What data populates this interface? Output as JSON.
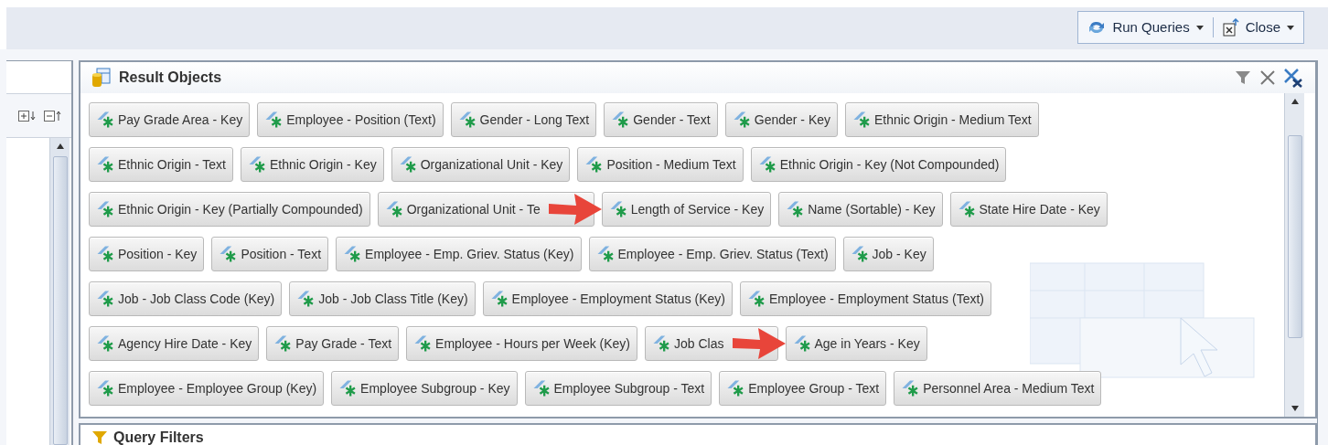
{
  "toolbar": {
    "buttons": [
      {
        "label": "Run Queries",
        "kind": "refresh"
      },
      {
        "label": "Close",
        "kind": "close"
      }
    ]
  },
  "result_objects": {
    "title": "Result Objects",
    "rows": [
      [
        {
          "label": "Pay Grade Area - Key",
          "arrow": false
        },
        {
          "label": "Employee - Position (Text)",
          "arrow": false
        },
        {
          "label": "Gender - Long Text",
          "arrow": false
        },
        {
          "label": "Gender - Text",
          "arrow": false
        },
        {
          "label": "Gender - Key",
          "arrow": false
        },
        {
          "label": "Ethnic Origin - Medium Text",
          "arrow": false
        }
      ],
      [
        {
          "label": "Ethnic Origin - Text",
          "arrow": false
        },
        {
          "label": "Ethnic Origin - Key",
          "arrow": false
        },
        {
          "label": "Organizational Unit - Key",
          "arrow": false
        },
        {
          "label": "Position - Medium Text",
          "arrow": false
        },
        {
          "label": "Ethnic Origin - Key (Not Compounded)",
          "arrow": false
        }
      ],
      [
        {
          "label": "Ethnic Origin - Key (Partially Compounded)",
          "arrow": false
        },
        {
          "label": "Organizational Unit - Te",
          "arrow": false
        },
        {
          "label": "Length of Service - Key",
          "arrow": true
        },
        {
          "label": "Name (Sortable) - Key",
          "arrow": false
        },
        {
          "label": "State Hire Date - Key",
          "arrow": false
        }
      ],
      [
        {
          "label": "Position - Key",
          "arrow": false
        },
        {
          "label": "Position - Text",
          "arrow": false
        },
        {
          "label": "Employee - Emp. Griev. Status (Key)",
          "arrow": false
        },
        {
          "label": "Employee - Emp. Griev. Status (Text)",
          "arrow": false
        },
        {
          "label": "Job - Key",
          "arrow": false
        }
      ],
      [
        {
          "label": "Job - Job Class Code (Key)",
          "arrow": false
        },
        {
          "label": "Job - Job Class Title (Key)",
          "arrow": false
        },
        {
          "label": "Employee - Employment Status (Key)",
          "arrow": false
        },
        {
          "label": "Employee - Employment Status (Text)",
          "arrow": false
        }
      ],
      [
        {
          "label": "Agency Hire Date - Key",
          "arrow": false
        },
        {
          "label": "Pay Grade - Text",
          "arrow": false
        },
        {
          "label": "Employee - Hours per Week (Key)",
          "arrow": false
        },
        {
          "label": "Job Clas",
          "arrow": false
        },
        {
          "label": "Age in Years - Key",
          "arrow": true
        }
      ],
      [
        {
          "label": "Employee - Employee Group (Key)",
          "arrow": false
        },
        {
          "label": "Employee Subgroup - Key",
          "arrow": false
        },
        {
          "label": "Employee Subgroup - Text",
          "arrow": false
        },
        {
          "label": "Employee Group - Text",
          "arrow": false
        },
        {
          "label": "Personnel Area - Medium Text",
          "arrow": false
        }
      ]
    ]
  },
  "query_filters": {
    "title": "Query Filters"
  }
}
